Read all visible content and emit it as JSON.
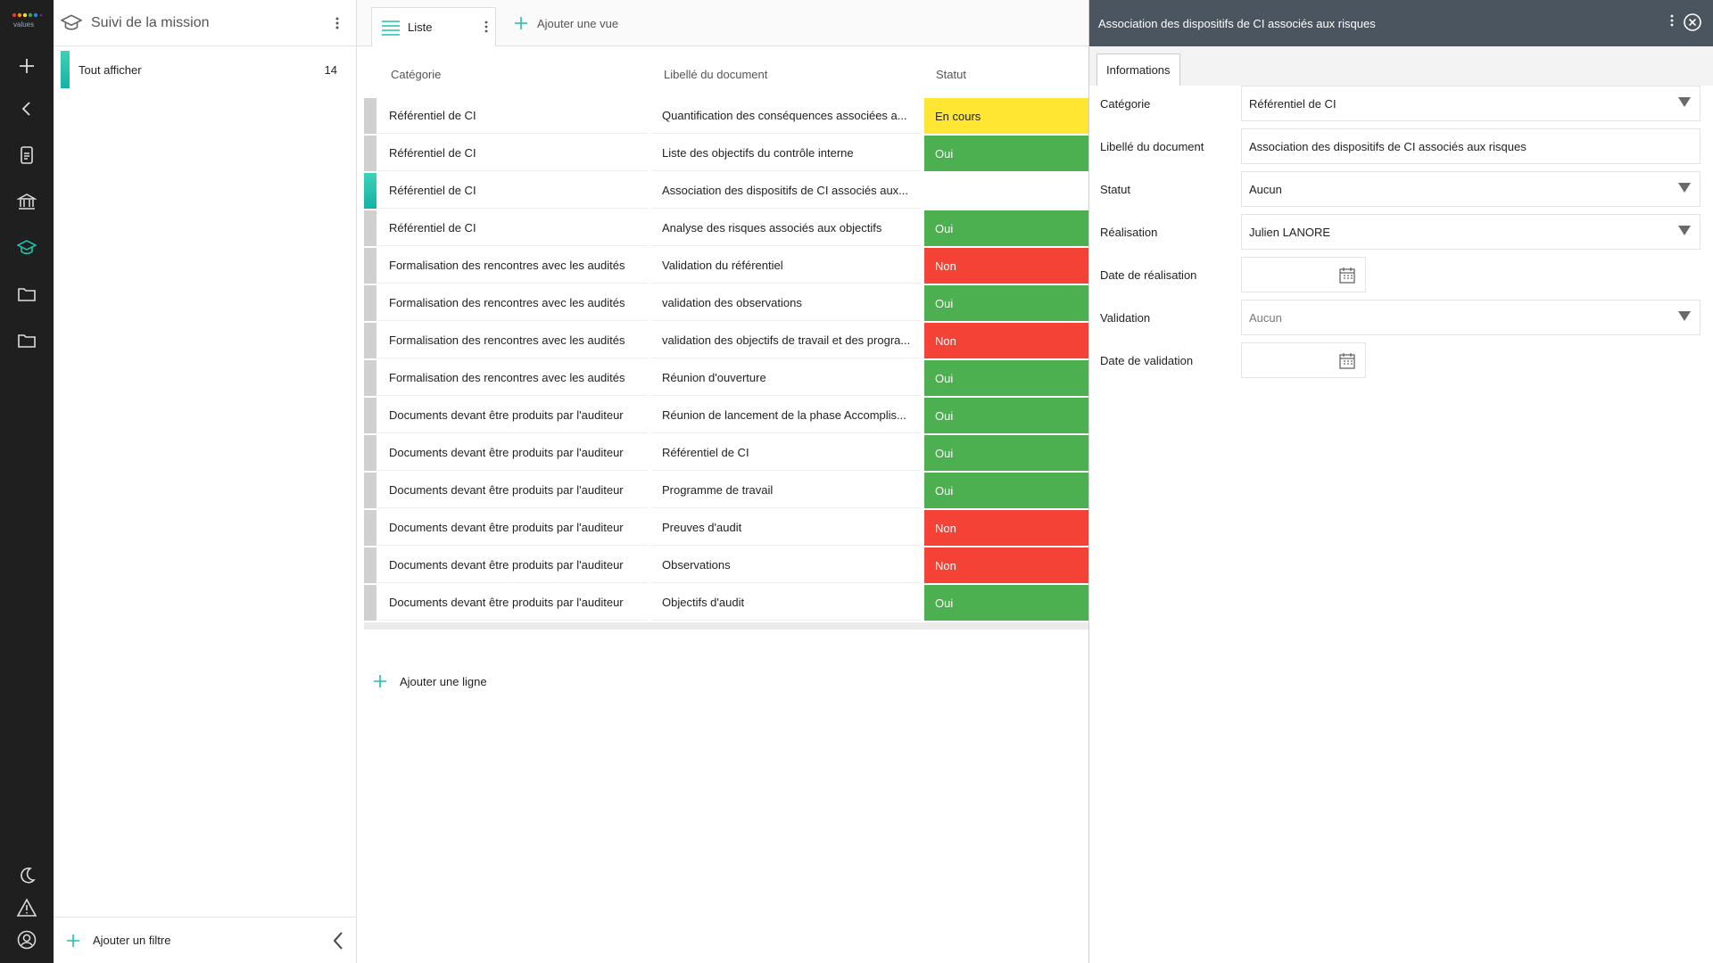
{
  "app": {
    "logo_text": "values"
  },
  "filter_panel": {
    "title": "Suivi de la mission",
    "filters": [
      {
        "label": "Tout afficher",
        "count": "14"
      }
    ],
    "add_filter_label": "Ajouter un filtre"
  },
  "view_bar": {
    "active_tab": "Liste",
    "add_view_label": "Ajouter une vue"
  },
  "table": {
    "columns": [
      "Catégorie",
      "Libellé du document",
      "Statut"
    ],
    "rows": [
      {
        "category": "Référentiel de CI",
        "label": "Quantification des conséquences associées a...",
        "status": "En cours",
        "status_color": "#ffe633",
        "status_text_color": "#222222",
        "selected": false
      },
      {
        "category": "Référentiel de CI",
        "label": "Liste des objectifs du contrôle interne",
        "status": "Oui",
        "status_color": "#4caf50",
        "status_text_color": "#ffffff",
        "selected": false
      },
      {
        "category": "Référentiel de CI",
        "label": "Association des dispositifs de CI associés aux...",
        "status": "",
        "status_color": "#ffffff",
        "status_text_color": "#ffffff",
        "selected": true
      },
      {
        "category": "Référentiel de CI",
        "label": "Analyse des risques associés aux objectifs",
        "status": "Oui",
        "status_color": "#4caf50",
        "status_text_color": "#ffffff",
        "selected": false
      },
      {
        "category": "Formalisation des rencontres avec les audités",
        "label": "Validation du référentiel",
        "status": "Non",
        "status_color": "#f44336",
        "status_text_color": "#ffffff",
        "selected": false
      },
      {
        "category": "Formalisation des rencontres avec les audités",
        "label": "validation des observations",
        "status": "Oui",
        "status_color": "#4caf50",
        "status_text_color": "#ffffff",
        "selected": false
      },
      {
        "category": "Formalisation des rencontres avec les audités",
        "label": "validation des objectifs de travail et des progra...",
        "status": "Non",
        "status_color": "#f44336",
        "status_text_color": "#ffffff",
        "selected": false
      },
      {
        "category": "Formalisation des rencontres avec les audités",
        "label": "Réunion d'ouverture",
        "status": "Oui",
        "status_color": "#4caf50",
        "status_text_color": "#ffffff",
        "selected": false
      },
      {
        "category": "Documents devant être produits par l'auditeur",
        "label": "Réunion de lancement de la phase Accomplis...",
        "status": "Oui",
        "status_color": "#4caf50",
        "status_text_color": "#ffffff",
        "selected": false
      },
      {
        "category": "Documents devant être produits par l'auditeur",
        "label": "Référentiel de CI",
        "status": "Oui",
        "status_color": "#4caf50",
        "status_text_color": "#ffffff",
        "selected": false
      },
      {
        "category": "Documents devant être produits par l'auditeur",
        "label": "Programme de travail",
        "status": "Oui",
        "status_color": "#4caf50",
        "status_text_color": "#ffffff",
        "selected": false
      },
      {
        "category": "Documents devant être produits par l'auditeur",
        "label": "Preuves d'audit",
        "status": "Non",
        "status_color": "#f44336",
        "status_text_color": "#ffffff",
        "selected": false
      },
      {
        "category": "Documents devant être produits par l'auditeur",
        "label": "Observations",
        "status": "Non",
        "status_color": "#f44336",
        "status_text_color": "#ffffff",
        "selected": false
      },
      {
        "category": "Documents devant être produits par l'auditeur",
        "label": "Objectifs d'audit",
        "status": "Oui",
        "status_color": "#4caf50",
        "status_text_color": "#ffffff",
        "selected": false
      }
    ],
    "add_line_label": "Ajouter une ligne"
  },
  "detail": {
    "title": "Association des dispositifs de CI associés aux risques",
    "tab": "Informations",
    "fields": [
      {
        "label": "Catégorie",
        "value": "Référentiel de CI",
        "type": "select",
        "placeholder": false
      },
      {
        "label": "Libellé du document",
        "value": "Association des dispositifs de CI associés aux risques",
        "type": "text",
        "placeholder": false
      },
      {
        "label": "Statut",
        "value": "Aucun",
        "type": "select",
        "placeholder": false
      },
      {
        "label": "Réalisation",
        "value": "Julien LANORE",
        "type": "select",
        "placeholder": false
      },
      {
        "label": "Date de réalisation",
        "value": "",
        "type": "date",
        "placeholder": false
      },
      {
        "label": "Validation",
        "value": "Aucun",
        "type": "select",
        "placeholder": true
      },
      {
        "label": "Date de validation",
        "value": "",
        "type": "date",
        "placeholder": false
      }
    ]
  },
  "colors": {
    "accent": "#1fc0aa",
    "rail": "#1f1f1f",
    "detail_header": "#4a5560"
  }
}
